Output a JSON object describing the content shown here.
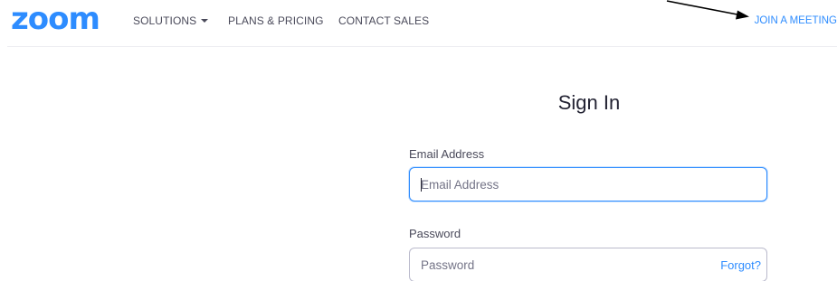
{
  "header": {
    "logo_text": "zoom",
    "nav": {
      "solutions_label": "SOLUTIONS",
      "plans_label": "PLANS & PRICING",
      "contact_label": "CONTACT SALES"
    },
    "join_label": "JOIN A MEETING"
  },
  "signin": {
    "title": "Sign In",
    "email": {
      "label": "Email Address",
      "placeholder": "Email Address",
      "value": ""
    },
    "password": {
      "label": "Password",
      "placeholder": "Password",
      "value": "",
      "forgot_label": "Forgot?"
    }
  },
  "colors": {
    "brand": "#2d8cff",
    "text": "#232333",
    "muted": "#4a4a5a"
  },
  "icons": [
    "caret-down-icon",
    "annotation-arrow-icon"
  ]
}
